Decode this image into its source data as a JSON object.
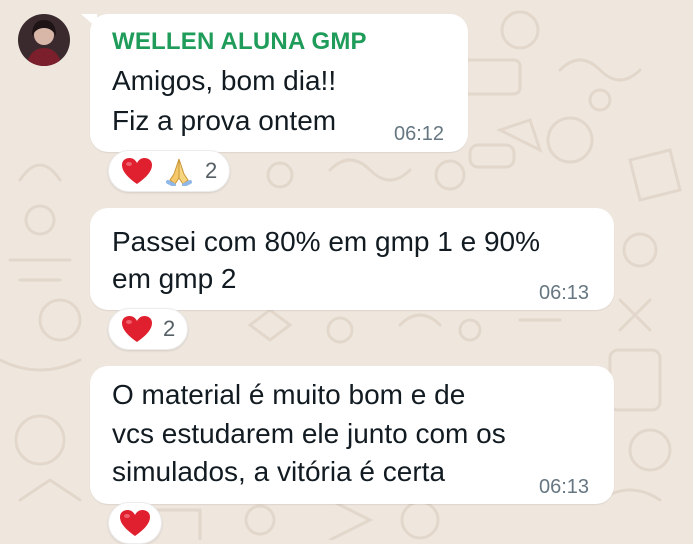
{
  "sender": {
    "name": "WELLEN ALUNA GMP",
    "name_color": "#1f9c5a",
    "avatar_icon": "profile-photo"
  },
  "messages": [
    {
      "lines": [
        "Amigos, bom dia!!",
        "Fiz a prova ontem"
      ],
      "time": "06:12",
      "reactions": {
        "emojis": [
          "red-heart",
          "folded-hands"
        ],
        "count": "2"
      }
    },
    {
      "lines": [
        "Passei com 80% em gmp 1 e 90%",
        "em gmp 2"
      ],
      "time": "06:13",
      "reactions": {
        "emojis": [
          "red-heart"
        ],
        "count": "2"
      }
    },
    {
      "lines": [
        "O material é muito bom e de",
        "vcs estudarem ele junto com os",
        "simulados, a vitória é certa"
      ],
      "time": "06:13",
      "reactions": {
        "emojis": [
          "red-heart"
        ]
      }
    }
  ],
  "colors": {
    "background": "#efe7de",
    "bubble": "#ffffff",
    "text": "#111b21",
    "timestamp": "#667781",
    "heart": "#e0202f"
  }
}
